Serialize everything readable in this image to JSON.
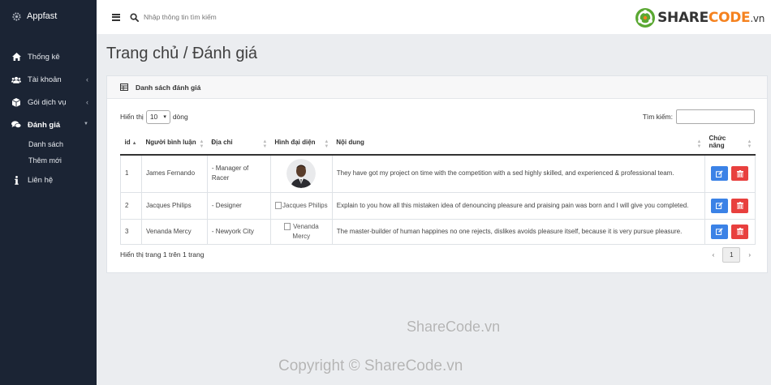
{
  "app": {
    "name": "Appfast"
  },
  "sidebar": {
    "items": [
      {
        "label": "Thống kê",
        "icon": "home-icon"
      },
      {
        "label": "Tài khoản",
        "icon": "users-icon"
      },
      {
        "label": "Gói dịch vụ",
        "icon": "box-icon"
      },
      {
        "label": "Đánh giá",
        "icon": "comments-icon"
      },
      {
        "label": "Liên hệ",
        "icon": "info-icon"
      }
    ],
    "sub_items": [
      {
        "label": "Danh sách"
      },
      {
        "label": "Thêm mới"
      }
    ]
  },
  "topbar": {
    "search_placeholder": "Nhập thông tin tìm kiếm"
  },
  "logo": {
    "part1": "SHARE",
    "part2": "CODE",
    "part3": ".vn"
  },
  "page": {
    "title": "Trang chủ / Đánh giá"
  },
  "card": {
    "title": "Danh sách đánh giá"
  },
  "controls": {
    "show_prefix": "Hiển thị",
    "page_length": "10",
    "show_suffix": "dòng",
    "search_label": "Tìm kiếm:"
  },
  "table": {
    "headers": [
      "id",
      "Người bình luận",
      "Địa chỉ",
      "Hình đại diện",
      "Nội dung",
      "Chức năng"
    ],
    "rows": [
      {
        "id": "1",
        "name": "James Fernando",
        "address": "- Manager of Racer",
        "avatar_alt": "",
        "content": "They have got my project on time with the competition with a sed highly skilled, and experienced & professional team."
      },
      {
        "id": "2",
        "name": "Jacques Philips",
        "address": "- Designer",
        "avatar_alt": "Jacques Philips",
        "content": "Explain to you how all this mistaken idea of denouncing pleasure and praising pain was born and I will give you completed."
      },
      {
        "id": "3",
        "name": "Venanda Mercy",
        "address": "- Newyork City",
        "avatar_alt": "Venanda Mercy",
        "content": "The master-builder of human happines no one rejects, dislikes avoids pleasure itself, because it is very pursue pleasure."
      }
    ]
  },
  "footer": {
    "info": "Hiển thị trang 1 trên 1 trang",
    "prev": "‹",
    "page": "1",
    "next": "›"
  },
  "watermarks": [
    "ShareCode.vn",
    "Copyright © ShareCode.vn"
  ],
  "colors": {
    "sidebar": "#1b2434",
    "edit": "#3b82e6",
    "delete": "#e8403e",
    "logo_accent": "#f5821f"
  }
}
